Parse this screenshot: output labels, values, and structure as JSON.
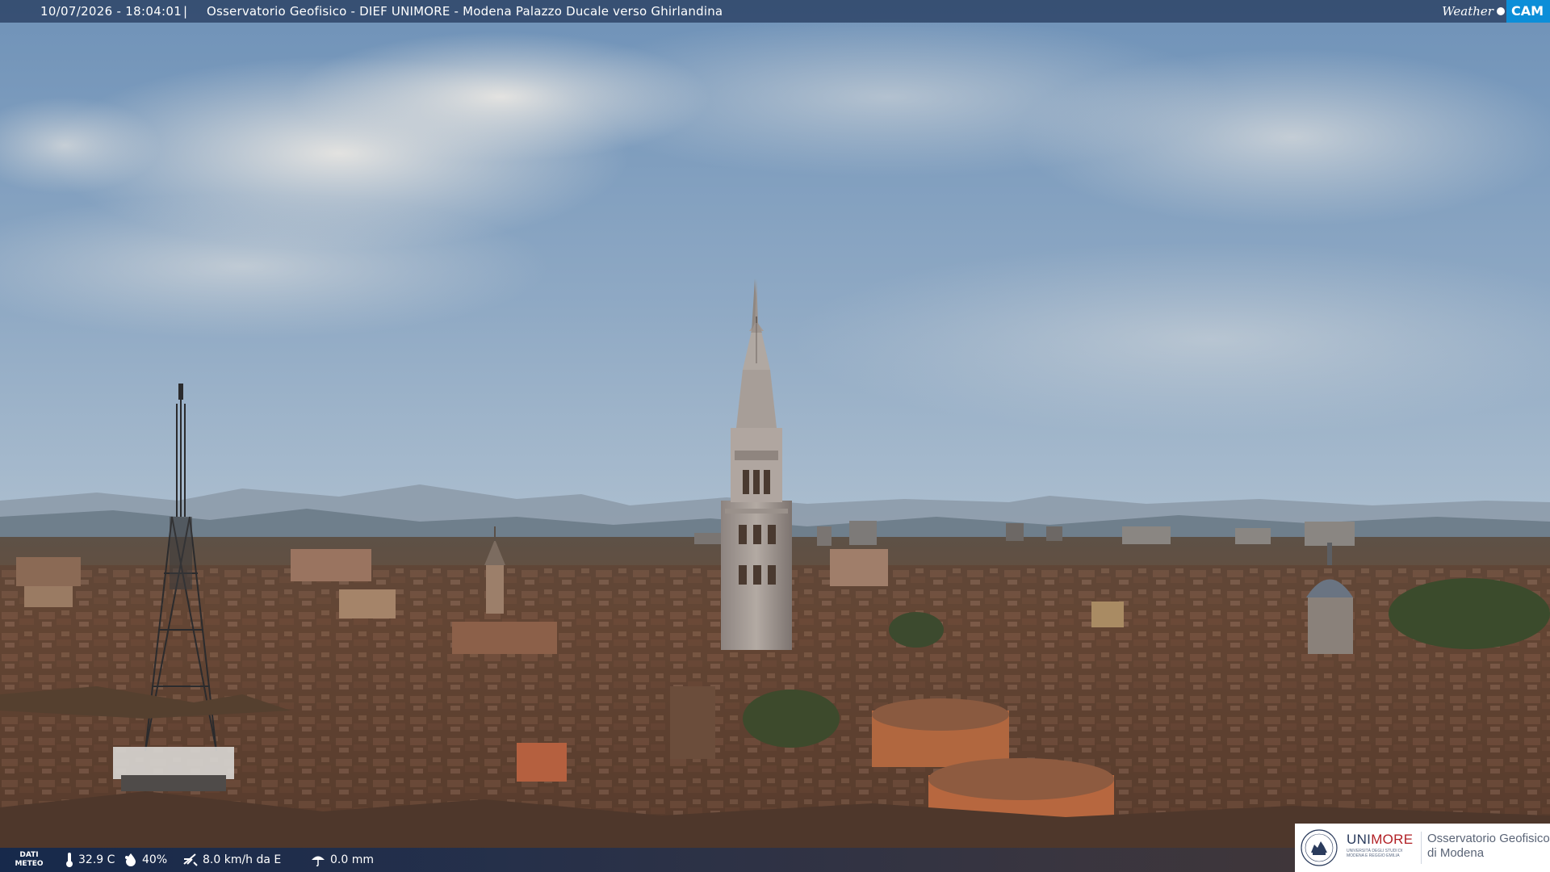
{
  "top_bar": {
    "datetime": "10/07/2026 - 18:04:01",
    "separator": "|",
    "title": "Osservatorio Geofisico - DIEF UNIMORE - Modena Palazzo Ducale verso Ghirlandina"
  },
  "logo": {
    "part1": "Weather",
    "part2": "CAM"
  },
  "meteo": {
    "label_line1": "DATI",
    "label_line2": "METEO",
    "temperature": "32.9 C",
    "humidity": "40%",
    "wind": "8.0 km/h da E",
    "rain": "0.0 mm",
    "icons": [
      "thermometer-icon",
      "humidity-drop-icon",
      "wind-icon",
      "rain-icon"
    ]
  },
  "unimore": {
    "name_a": "UNI",
    "name_b": "MORE",
    "subtitle": "UNIVERSITÀ DEGLI STUDI DI MODENA E REGGIO EMILIA",
    "observatory_line1": "Osservatorio Geofisico",
    "observatory_line2": "di Modena"
  },
  "colors": {
    "top_bar": "#283e60",
    "logo_blue": "#0c8ed8",
    "unimore_red": "#b11f24",
    "unimore_navy": "#2a3b5c"
  }
}
